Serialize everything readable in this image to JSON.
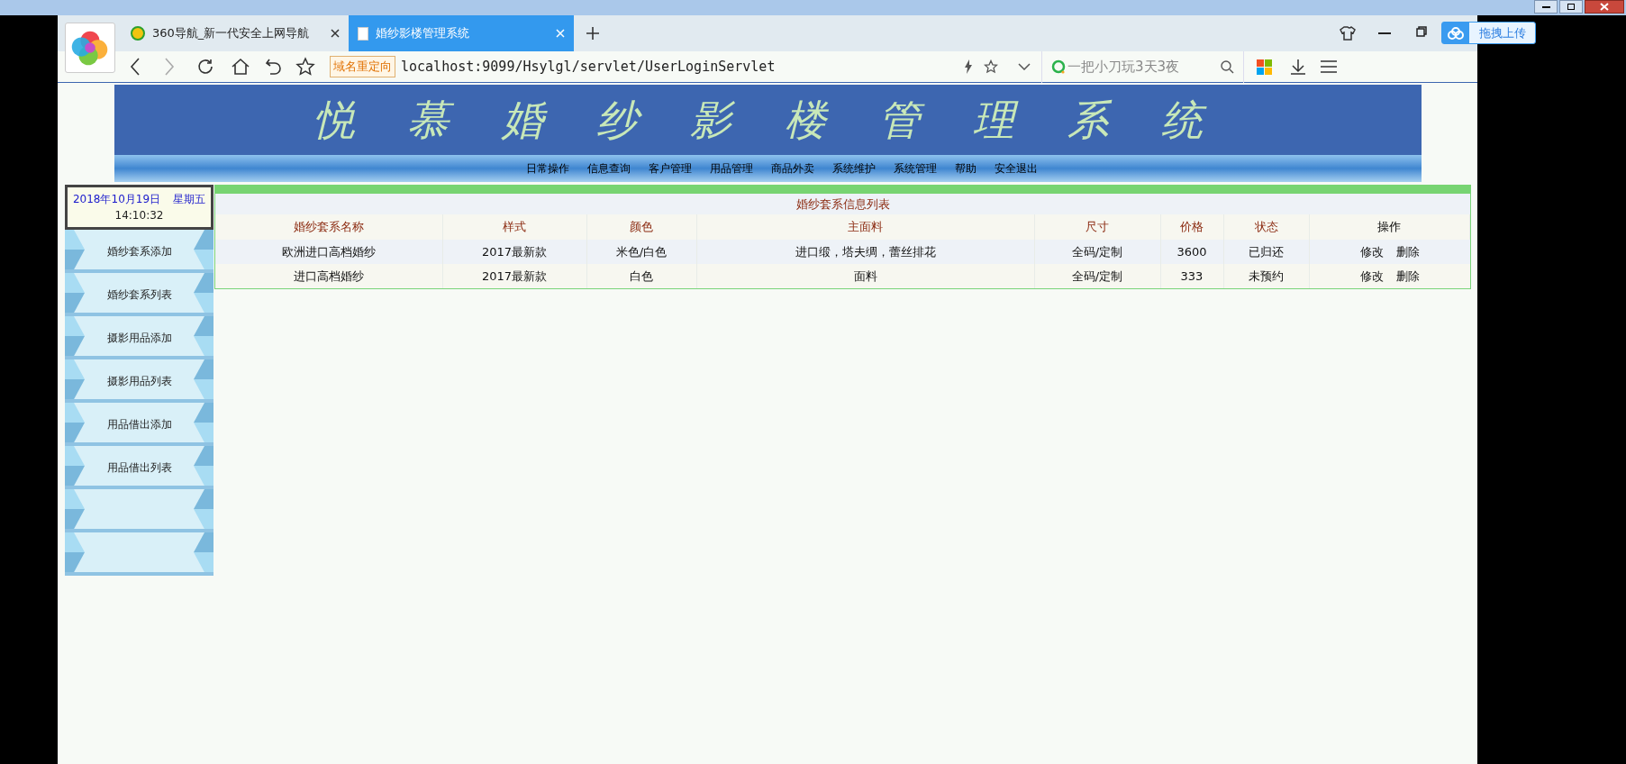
{
  "browser": {
    "tabs": [
      {
        "label": "360导航_新一代安全上网导航",
        "selected": false
      },
      {
        "label": "婚纱影楼管理系统",
        "selected": true
      }
    ],
    "redirect_badge": "域名重定向",
    "url": "localhost:9099/Hsylgl/servlet/UserLoginServlet",
    "search": {
      "placeholder": "一把小刀玩3天3夜"
    },
    "upload_button": "拖拽上传"
  },
  "header": {
    "title": "悦 慕 婚 纱 影 楼 管 理 系 统"
  },
  "nav": [
    "日常操作",
    "信息查询",
    "客户管理",
    "用品管理",
    "商品外卖",
    "系统维护",
    "系统管理",
    "帮助",
    "安全退出"
  ],
  "clock": {
    "date": "2018年10月19日",
    "weekday": "星期五",
    "time": "14:10:32"
  },
  "sidebar": {
    "items": [
      {
        "kind": "link",
        "label": "婚纱套系添加"
      },
      {
        "kind": "link",
        "label": "婚纱套系列表"
      },
      {
        "kind": "link",
        "label": "摄影用品添加"
      },
      {
        "kind": "link",
        "label": "摄影用品列表"
      },
      {
        "kind": "link",
        "label": "用品借出添加"
      },
      {
        "kind": "link",
        "label": "用品借出列表"
      },
      {
        "kind": "blank"
      },
      {
        "kind": "blank"
      }
    ]
  },
  "table": {
    "title": "婚纱套系信息列表",
    "columns": [
      "婚纱套系名称",
      "样式",
      "颜色",
      "主面料",
      "尺寸",
      "价格",
      "状态",
      "操作"
    ],
    "rows": [
      {
        "cells": [
          "欧洲进口高档婚纱",
          "2017最新款",
          "米色/白色",
          "进口缎，塔夫绸，蕾丝排花",
          "全码/定制",
          "3600",
          "已归还"
        ],
        "actions": [
          "修改",
          "删除"
        ]
      },
      {
        "cells": [
          "进口高档婚纱",
          "2017最新款",
          "白色",
          "面料",
          "全码/定制",
          "333",
          "未预约"
        ],
        "actions": [
          "修改",
          "删除"
        ]
      }
    ]
  }
}
